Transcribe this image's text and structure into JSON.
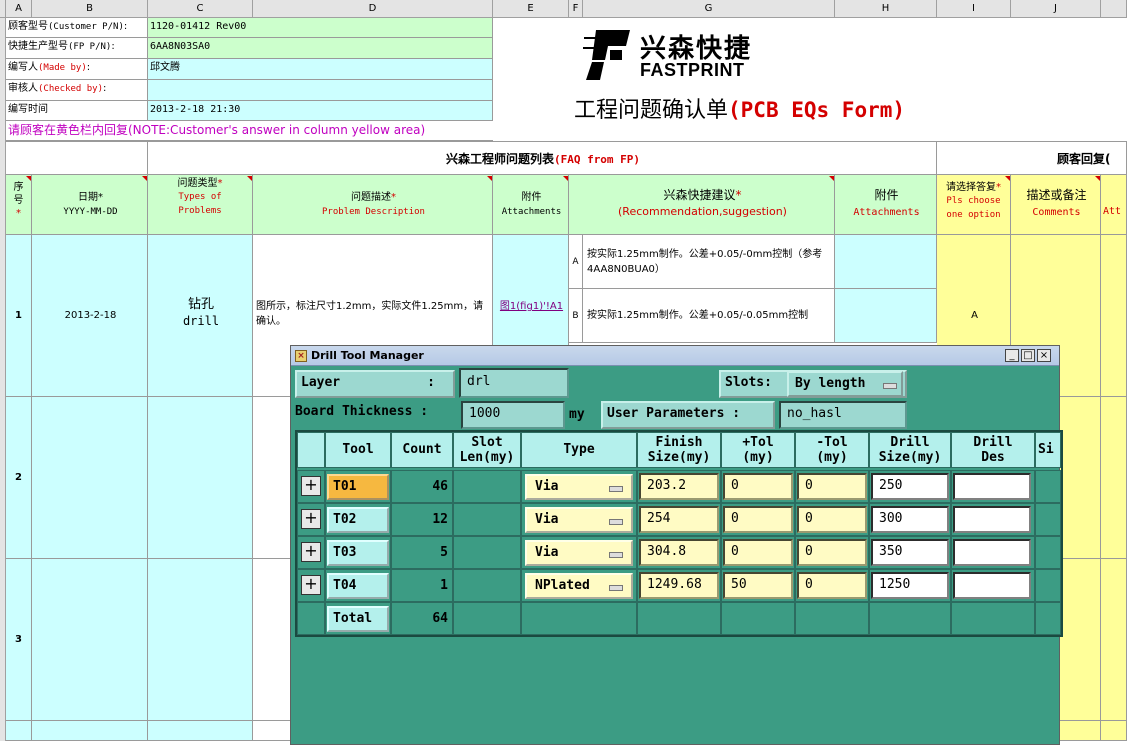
{
  "sheet": {
    "columns": [
      "A",
      "B",
      "C",
      "D",
      "E",
      "F",
      "G",
      "H",
      "I",
      "J"
    ],
    "info": [
      {
        "label": "顾客型号",
        "label_en": "(Customer P/N)",
        "value": "1120-01412 Rev00"
      },
      {
        "label": "快捷生产型号",
        "label_en": "(FP P/N)",
        "value": "6AA8N03SA0"
      },
      {
        "label": "编写人",
        "label_en": "(Made by)",
        "value": "邱文腾"
      },
      {
        "label": "审核人",
        "label_en": "(Checked by)",
        "value": ""
      },
      {
        "label": "编写时间",
        "label_en": "",
        "value": "2013-2-18 21:30"
      }
    ],
    "note": "请顾客在黄色栏内回复(NOTE:Customer's answer in column yellow area)",
    "logo_cn": "兴森快捷",
    "logo_en": "FASTPRINT",
    "form_title_cn": "工程问题确认单",
    "form_title_en": "(PCB EQs Form)",
    "section_fp_cn": "兴森工程师问题列表",
    "section_fp_en": "(FAQ from FP)",
    "section_customer": "顾客回复(",
    "headers": {
      "seq": "序号",
      "date_cn": "日期",
      "date_fmt": "YYYY-MM-DD",
      "type_cn": "问题类型",
      "type_en": "Types of Problems",
      "desc_cn": "问题描述",
      "desc_en": "Problem Description",
      "attach_cn": "附件",
      "attach_en": "Attachments",
      "rec_cn": "兴森快捷建议",
      "rec_en": "(Recommendation,suggestion)",
      "attach2_cn": "附件",
      "attach2_en": "Attachments",
      "choose_cn": "请选择答复",
      "choose_en": "Pls choose one option",
      "comment_cn": "描述或备注",
      "comment_en": "Comments",
      "attach3_en": "Att"
    },
    "rows": [
      {
        "num": "1",
        "date": "2013-2-18",
        "type_cn": "钻孔",
        "type_en": "drill",
        "desc": "图所示，标注尺寸1.2mm，实际文件1.25mm，请确认。",
        "attach": "图1(fig1)'!A1",
        "option_a_key": "A",
        "option_a": "按实际1.25mm制作。公差+0.05/-0mm控制（参考4AA8N0BUA0）",
        "option_b_key": "B",
        "option_b": "按实际1.25mm制作。公差+0.05/-0.05mm控制",
        "answer": "A"
      },
      {
        "num": "2"
      },
      {
        "num": "3"
      }
    ]
  },
  "dialog": {
    "title": "Drill Tool Manager",
    "layer_label": "Layer",
    "layer_colon": ":",
    "layer_value": "drl",
    "slots_label": "Slots:",
    "slots_value": "By length",
    "thickness_label": "Board Thickness :",
    "thickness_value": "1000",
    "thickness_unit": "my",
    "user_params_label": "User Parameters :",
    "user_params_value": "no_hasl",
    "table_headers": [
      "Tool",
      "Count",
      "Slot Len(my)",
      "Type",
      "Finish Size(my)",
      "+Tol (my)",
      "-Tol (my)",
      "Drill Size(my)",
      "Drill Des",
      "Si"
    ],
    "tools": [
      {
        "tool": "T01",
        "count": "46",
        "type": "Via",
        "finish": "203.2",
        "ptol": "0",
        "ntol": "0",
        "drill": "250",
        "des": "",
        "selected": true
      },
      {
        "tool": "T02",
        "count": "12",
        "type": "Via",
        "finish": "254",
        "ptol": "0",
        "ntol": "0",
        "drill": "300",
        "des": "",
        "selected": false
      },
      {
        "tool": "T03",
        "count": "5",
        "type": "Via",
        "finish": "304.8",
        "ptol": "0",
        "ntol": "0",
        "drill": "350",
        "des": "",
        "selected": false
      },
      {
        "tool": "T04",
        "count": "1",
        "type": "NPlated",
        "finish": "1249.68",
        "ptol": "50",
        "ntol": "0",
        "drill": "1250",
        "des": "",
        "selected": false
      }
    ],
    "total_label": "Total",
    "total_count": "64"
  }
}
